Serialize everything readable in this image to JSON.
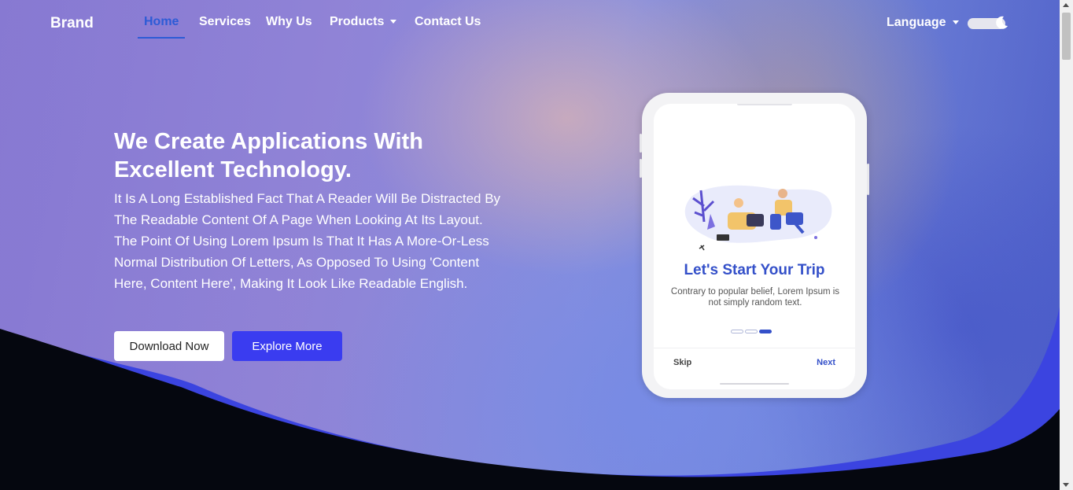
{
  "navbar": {
    "brand": "Brand",
    "items": [
      {
        "label": "Home"
      },
      {
        "label": "Services"
      },
      {
        "label": "Why Us"
      },
      {
        "label": "Products"
      },
      {
        "label": "Contact Us"
      }
    ],
    "language_label": "Language"
  },
  "hero": {
    "title_line1": "We Create Applications With",
    "title_line2": "Excellent Technology.",
    "description": "It Is A Long Established Fact That A Reader Will Be Distracted By The Readable Content Of A Page When Looking At Its Layout. The Point Of Using Lorem Ipsum Is That It Has A More-Or-Less Normal Distribution Of Letters, As Opposed To Using 'Content Here, Content Here', Making It Look Like Readable English.",
    "download_label": "Download Now",
    "explore_label": "Explore More"
  },
  "phone": {
    "title": "Let's Start Your Trip",
    "description": "Contrary to popular belief, Lorem Ipsum is not simply random text.",
    "skip_label": "Skip",
    "next_label": "Next",
    "active_dot": 3
  },
  "colors": {
    "accent": "#2d5bd6",
    "primary_button": "#3a3cf0",
    "phone_title": "#3450c9",
    "dark_wave": "#05070f",
    "blue_wave": "#3b44e0"
  }
}
